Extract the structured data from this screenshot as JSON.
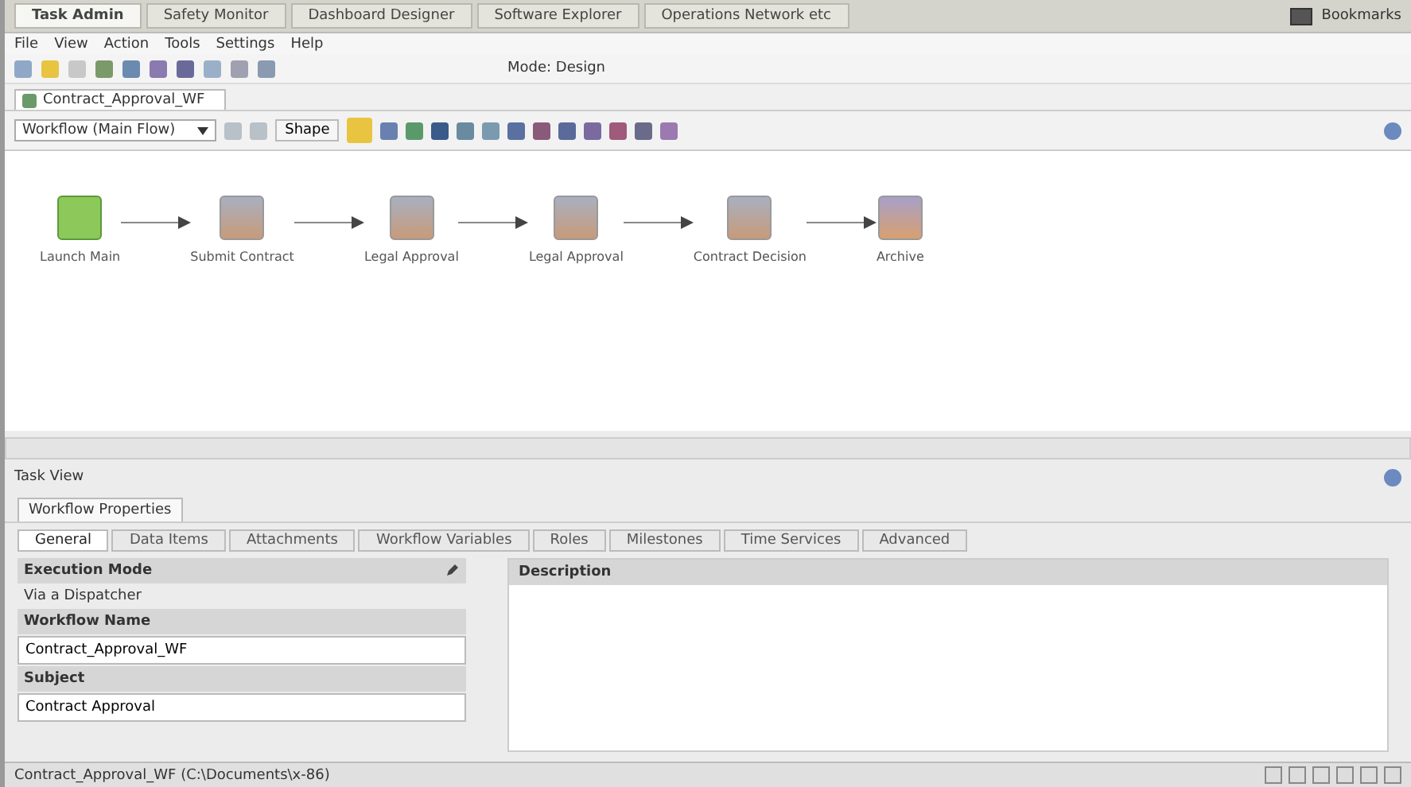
{
  "app_tabs": [
    {
      "label": "Task Admin",
      "selected": true
    },
    {
      "label": "Safety Monitor",
      "selected": false
    },
    {
      "label": "Dashboard Designer",
      "selected": false
    },
    {
      "label": "Software Explorer",
      "selected": false
    },
    {
      "label": "Operations Network etc",
      "selected": false
    }
  ],
  "bookmarks": "Bookmarks",
  "menu": [
    "File",
    "View",
    "Action",
    "Tools",
    "Settings",
    "Help"
  ],
  "mode": "Mode: Design",
  "document_tab": "Contract_Approval_WF",
  "workflow_select": "Workflow (Main Flow)",
  "shape_button": "Shape",
  "nodes": [
    {
      "label": "Launch Main",
      "kind": "start"
    },
    {
      "label": "Submit Contract",
      "kind": "task"
    },
    {
      "label": "Legal Approval",
      "kind": "task"
    },
    {
      "label": "Legal Approval",
      "kind": "task"
    },
    {
      "label": "Contract Decision",
      "kind": "task"
    },
    {
      "label": "Archive",
      "kind": "end"
    }
  ],
  "panel_title": "Task View",
  "properties_tab": "Workflow Properties",
  "sub_tabs": [
    {
      "label": "General",
      "selected": true
    },
    {
      "label": "Data Items",
      "selected": false
    },
    {
      "label": "Attachments",
      "selected": false
    },
    {
      "label": "Workflow Variables",
      "selected": false
    },
    {
      "label": "Roles",
      "selected": false
    },
    {
      "label": "Milestones",
      "selected": false
    },
    {
      "label": "Time Services",
      "selected": false
    },
    {
      "label": "Advanced",
      "selected": false
    }
  ],
  "fields": [
    {
      "label": "Execution Mode",
      "value": "Via a Dispatcher",
      "kind": "text"
    },
    {
      "label": "Workflow Name",
      "value": "Contract_Approval_WF",
      "kind": "input"
    },
    {
      "label": "Subject",
      "value": "Contract Approval",
      "kind": "input"
    }
  ],
  "description_label": "Description",
  "status_bar": "Contract_Approval_WF (C:\\Documents\\x-86)"
}
